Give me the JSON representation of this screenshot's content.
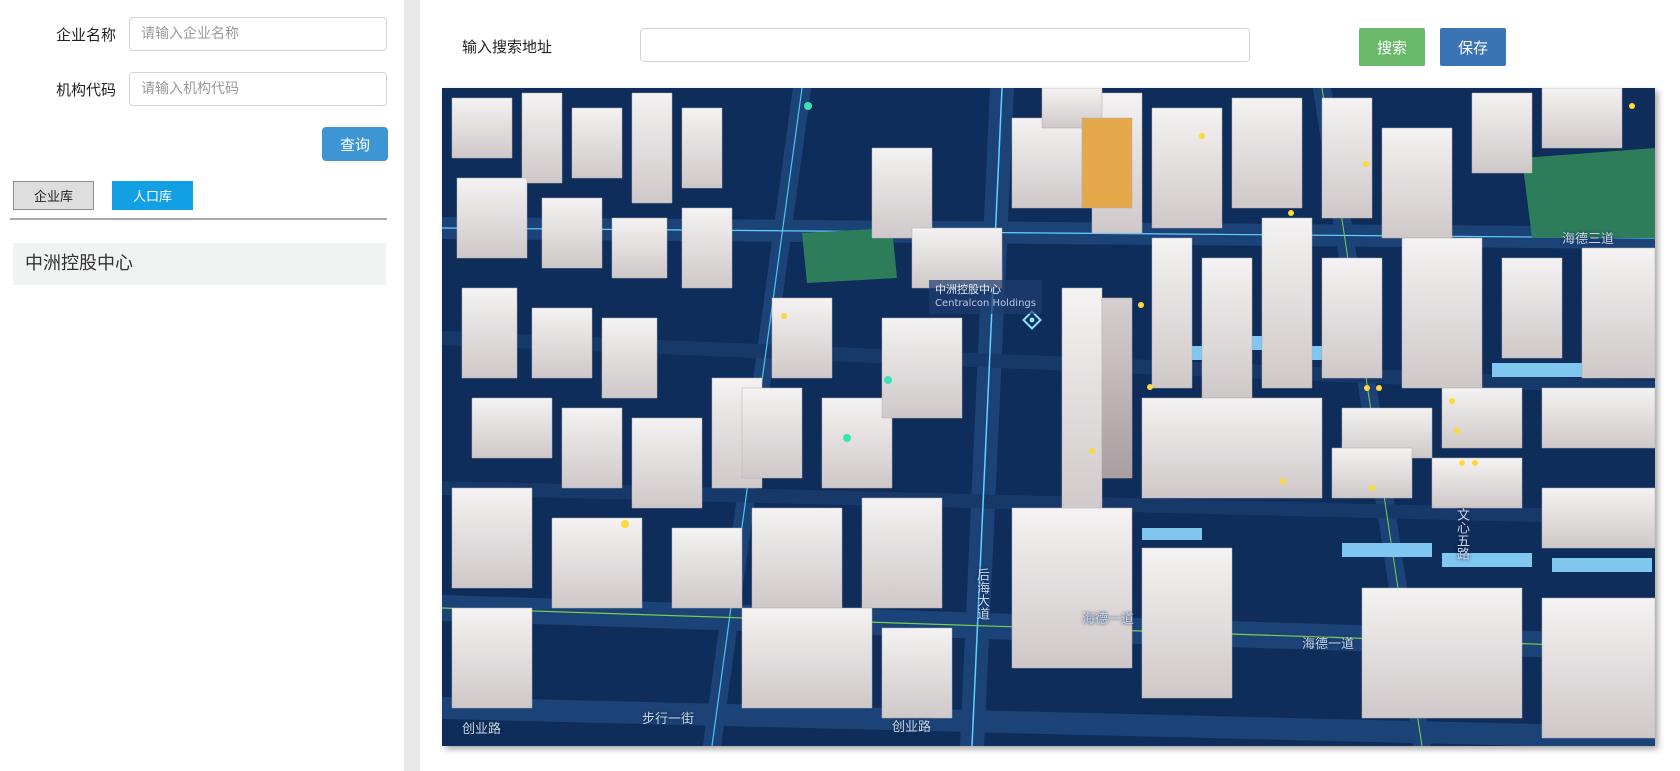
{
  "form": {
    "company_name_label": "企业名称",
    "company_name_placeholder": "请输入企业名称",
    "org_code_label": "机构代码",
    "org_code_placeholder": "请输入机构代码",
    "query_button": "查询"
  },
  "library_tabs": {
    "enterprise": "企业库",
    "population": "人口库"
  },
  "results": [
    "中洲控股中心"
  ],
  "search": {
    "label": "输入搜索地址",
    "value": "",
    "search_button": "搜索",
    "save_button": "保存"
  },
  "map": {
    "poi_name_cn": "中洲控股中心",
    "poi_name_en": "Centralcon Holdings",
    "streets": [
      "海德一道",
      "海德一道",
      "创业路",
      "创业路",
      "后海大道",
      "文心五路",
      "步行一街",
      "海德三道"
    ]
  },
  "colors": {
    "query_button": "#3d96d3",
    "population_tab": "#139fe3",
    "search_button": "#6ab86a",
    "save_button": "#3a74b4",
    "map_background": "#0f2d5a"
  }
}
